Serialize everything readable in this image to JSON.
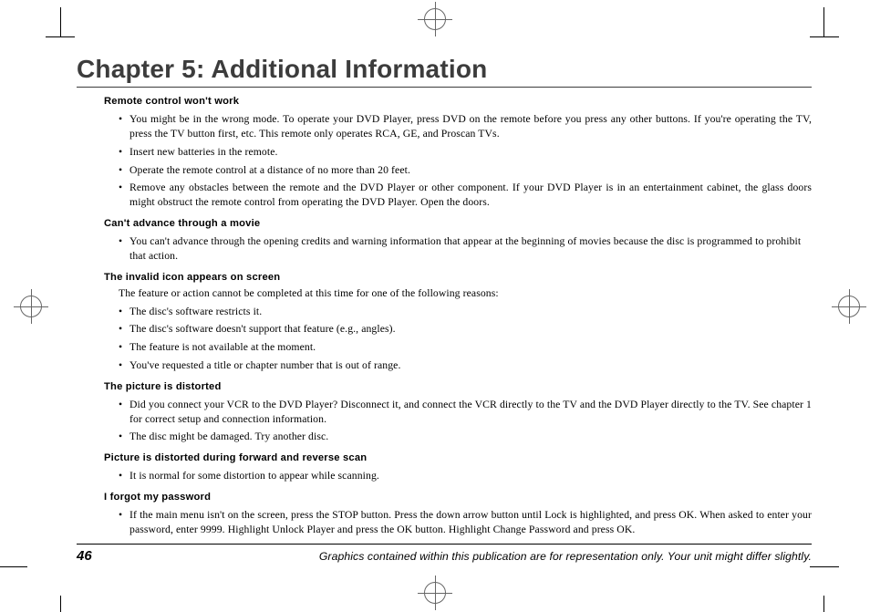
{
  "chapter_title": "Chapter 5: Additional Information",
  "sections": [
    {
      "heading": "Remote control won't work",
      "lead": "",
      "bullets": [
        "You might be in the wrong mode. To operate your DVD Player, press DVD on the remote before you press any other buttons. If you're operating the TV, press the TV button first, etc. This remote only operates RCA, GE, and Proscan TVs.",
        "Insert new batteries in the remote.",
        "Operate the remote control at a distance of no more than 20 feet.",
        "Remove any obstacles between the remote and the DVD Player or other component. If your DVD Player is in an entertainment cabinet, the glass doors might obstruct the remote control from operating the DVD Player. Open the doors."
      ]
    },
    {
      "heading": "Can't advance through a movie",
      "lead": "",
      "bullets": [
        "You can't advance through the opening credits and warning information that appear at the beginning of movies because the disc is programmed to prohibit that action."
      ]
    },
    {
      "heading": "The invalid icon appears on screen",
      "lead": "The feature or action cannot be completed at this time for one of the following reasons:",
      "bullets": [
        "The disc's software restricts it.",
        "The disc's software doesn't support that feature (e.g., angles).",
        "The feature is not available at the moment.",
        "You've requested a title or chapter number that is out of range."
      ]
    },
    {
      "heading": "The picture is distorted",
      "lead": "",
      "bullets": [
        "Did you connect your VCR to the DVD Player? Disconnect it, and connect the VCR directly to the TV and the DVD Player directly to the TV. See chapter 1 for correct setup and connection information.",
        "The disc might be damaged. Try another disc."
      ]
    },
    {
      "heading": "Picture is distorted during forward and reverse scan",
      "lead": "",
      "bullets": [
        "It is normal for some distortion to appear while scanning."
      ]
    },
    {
      "heading": "I forgot my password",
      "lead": "",
      "bullets": [
        "If the main menu isn't on the screen, press the STOP button. Press the down arrow button until Lock is highlighted, and press OK. When asked to enter your password, enter 9999. Highlight Unlock Player and press the OK button. Highlight Change Password and press OK."
      ]
    }
  ],
  "page_number": "46",
  "footer_caption": "Graphics contained within this publication are for representation only. Your unit might differ slightly."
}
